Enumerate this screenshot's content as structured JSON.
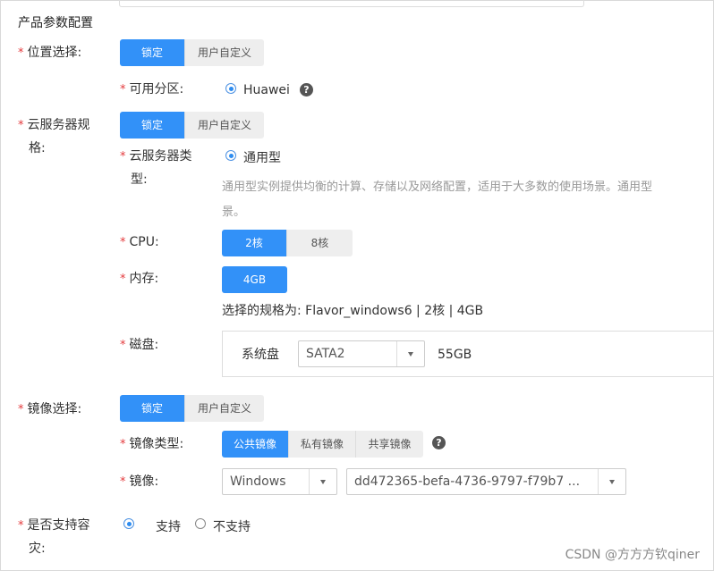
{
  "section_title": "产品参数配置",
  "required_mark": "*",
  "location": {
    "label": "位置选择:",
    "options": [
      "锁定",
      "用户自定义"
    ],
    "selected": "锁定",
    "zone_label": "可用分区:",
    "zone_value": "Huawei",
    "help": "?"
  },
  "spec": {
    "label_line1": "云服务器规",
    "label_line2": "格:",
    "options": [
      "锁定",
      "用户自定义"
    ],
    "selected": "锁定",
    "type_label_line1": "云服务器类",
    "type_label_line2": "型:",
    "type_value": "通用型",
    "type_desc_line1": "通用型实例提供均衡的计算、存储以及网络配置，适用于大多数的使用场景。通用型",
    "type_desc_line2": "景。",
    "cpu_label": "CPU:",
    "cpu_options": [
      "2核",
      "8核"
    ],
    "cpu_selected": "2核",
    "memory_label": "内存:",
    "memory_options": [
      "4GB"
    ],
    "memory_selected": "4GB",
    "summary": "选择的规格为: Flavor_windows6 | 2核 | 4GB",
    "disk_label": "磁盘:",
    "disk_name": "系统盘",
    "disk_type": "SATA2",
    "disk_size": "55GB"
  },
  "image": {
    "label": "镜像选择:",
    "options": [
      "锁定",
      "用户自定义"
    ],
    "selected": "锁定",
    "type_label": "镜像类型:",
    "type_options": [
      "公共镜像",
      "私有镜像",
      "共享镜像"
    ],
    "type_selected": "公共镜像",
    "help": "?",
    "image_label": "镜像:",
    "os_value": "Windows",
    "image_value": "dd472365-befa-4736-9797-f79b7 ..."
  },
  "dr": {
    "label_line1": "是否支持容",
    "label_line2": "灾:",
    "yes": "支持",
    "no": "不支持",
    "selected": "支持"
  },
  "watermark": "CSDN @方方方钦qiner",
  "colors": {
    "primary": "#3291f8",
    "required": "#e4393c",
    "hint": "#999999"
  }
}
